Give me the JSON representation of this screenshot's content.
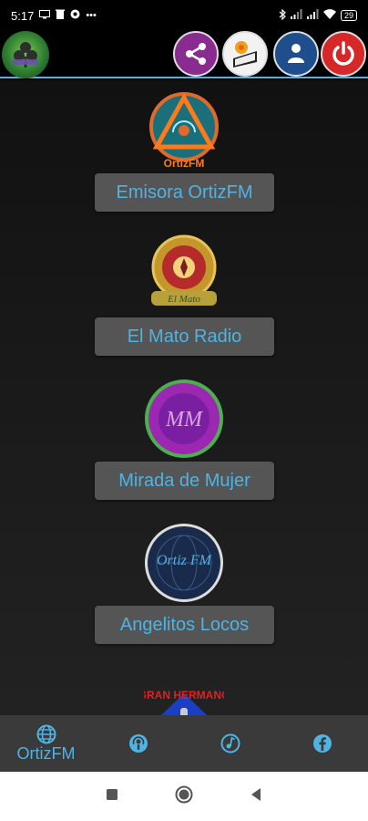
{
  "status_bar": {
    "time": "5:17",
    "left_icons": [
      "screen-icon",
      "trash-icon",
      "vpn-icon",
      "more-dots-icon"
    ],
    "right_icons": [
      "bluetooth-icon",
      "signal-icon",
      "signal-icon",
      "wifi-icon",
      "battery-icon"
    ],
    "battery_level": "29"
  },
  "app_bar": {
    "logo_icon": "club-logo-icon",
    "buttons": [
      {
        "name": "share",
        "icon": "share-icon"
      },
      {
        "name": "radio-player",
        "icon": "radio-icon"
      },
      {
        "name": "user",
        "icon": "user-icon"
      },
      {
        "name": "power",
        "icon": "power-icon"
      }
    ],
    "accent": "#4fb3e3"
  },
  "stations": [
    {
      "label": "Emisora OrtizFM",
      "logo": "ortizfm-logo",
      "logo_text": "OrtizFM"
    },
    {
      "label": "El Mato Radio",
      "logo": "el-mato-logo",
      "logo_text": "El Mato"
    },
    {
      "label": "Mirada de Mujer",
      "logo": "mirada-de-mujer-logo",
      "logo_text": "MM"
    },
    {
      "label": "Angelitos Locos",
      "logo": "ortiz-fm-globe-logo",
      "logo_text": "Ortiz FM"
    },
    {
      "label": "",
      "logo": "gran-hermano-logo",
      "logo_text": "GRAN HERMANO"
    }
  ],
  "bottom_nav": {
    "items": [
      {
        "icon": "globe-icon",
        "label": "OrtizFM"
      },
      {
        "icon": "podcast-icon",
        "label": ""
      },
      {
        "icon": "music-note-icon",
        "label": ""
      },
      {
        "icon": "facebook-icon",
        "label": ""
      }
    ]
  },
  "system_nav": {
    "buttons": [
      "recents-icon",
      "home-icon",
      "back-icon"
    ]
  }
}
